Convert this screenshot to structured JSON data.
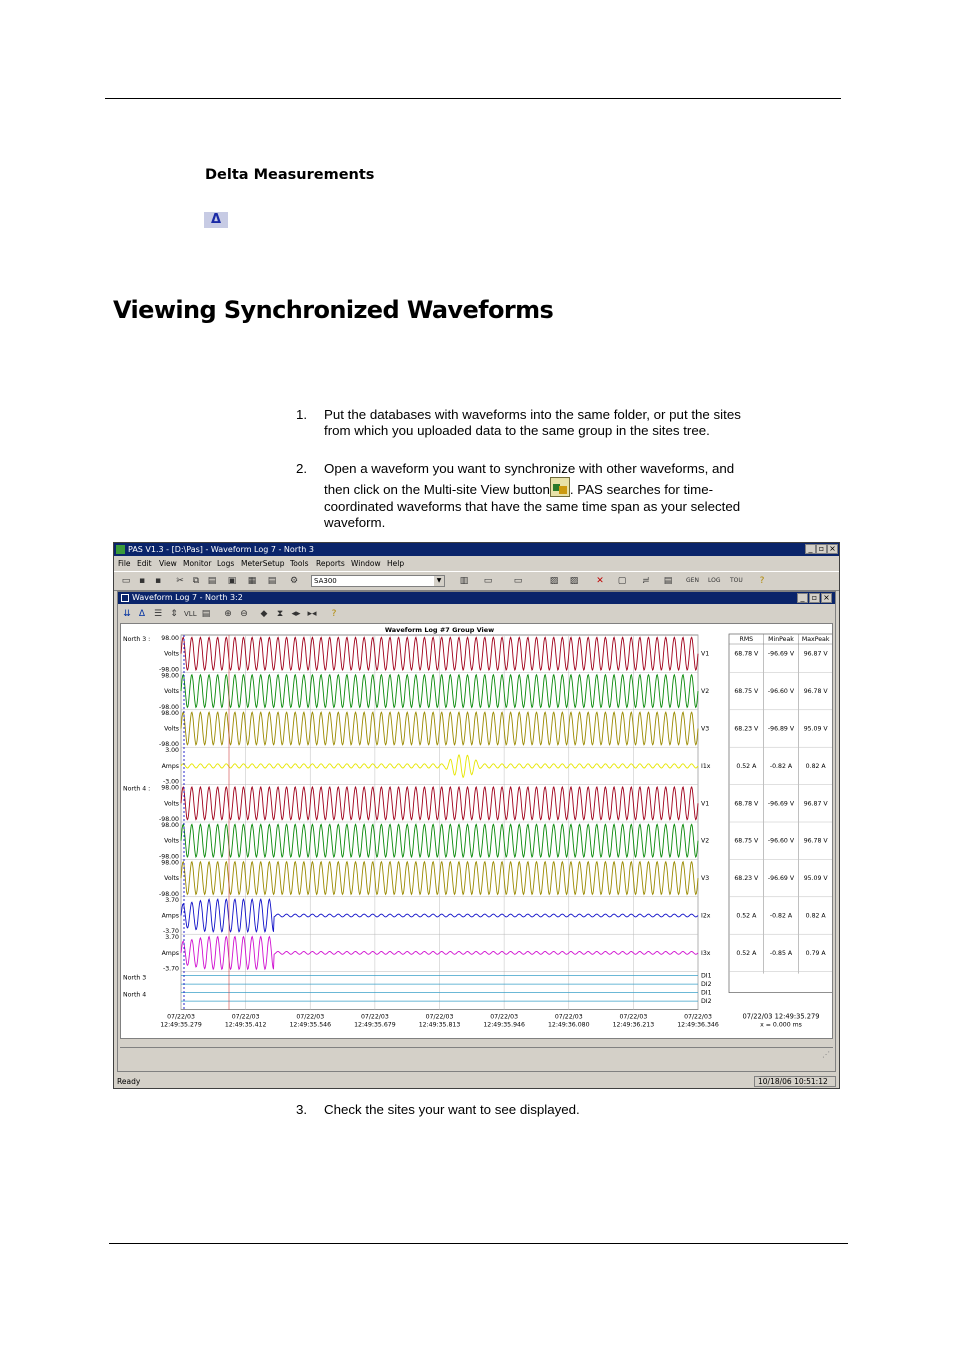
{
  "section_heading": "Delta Measurements",
  "delta_icon": "Δ",
  "page_title": "Viewing Synchronized Waveforms",
  "steps": [
    {
      "num": "1.",
      "text": "Put the databases with waveforms into the same folder, or put the sites from which you uploaded data to the same group in the sites tree."
    },
    {
      "num": "2.",
      "text_before": "Open a waveform you want to synchronize with other waveforms, and then click on the Multi-site View button",
      "text_after": ". PAS searches for time-coordinated waveforms that have the same time span as your selected waveform."
    },
    {
      "num": "3.",
      "text": "Check the sites your want to see displayed."
    }
  ],
  "app": {
    "title": "PAS V1.3 - [D:\\Pas] - Waveform Log 7 - North 3",
    "menu": [
      "File",
      "Edit",
      "View",
      "Monitor",
      "Logs",
      "MeterSetup",
      "Tools",
      "Reports",
      "Window",
      "Help"
    ],
    "combo_value": "SA300",
    "child_title": "Waveform Log 7 - North 3:2",
    "chart_title": "Waveform Log #7 Group View",
    "status_left": "Ready",
    "status_right": "10/18/06 10:51:12"
  },
  "chart_data": {
    "type": "line",
    "title": "Waveform Log #7 Group View",
    "groups": [
      "North 3 :",
      "North 4 :"
    ],
    "channels": [
      {
        "group": "North 3",
        "label": "V1",
        "unit": "Volts",
        "max": "98.00",
        "min": "-98.00",
        "color": "#a0001a",
        "amp": 0.95,
        "disturb": "none"
      },
      {
        "group": "North 3",
        "label": "V2",
        "unit": "Volts",
        "max": "98.00",
        "min": "-98.00",
        "color": "#0a8a0a",
        "amp": 0.95,
        "disturb": "none"
      },
      {
        "group": "North 3",
        "label": "V3",
        "unit": "Volts",
        "max": "98.00",
        "min": "-98.00",
        "color": "#9a8a00",
        "amp": 0.95,
        "disturb": "none"
      },
      {
        "group": "North 3",
        "label": "I1x",
        "unit": "Amps",
        "max": "3.00",
        "min": "-3.00",
        "color": "#e6e600",
        "amp": 0.12,
        "disturb": "mid"
      },
      {
        "group": "North 4",
        "label": "V1",
        "unit": "Volts",
        "max": "98.00",
        "min": "-98.00",
        "color": "#a0001a",
        "amp": 0.95,
        "disturb": "none"
      },
      {
        "group": "North 4",
        "label": "V2",
        "unit": "Volts",
        "max": "98.00",
        "min": "-98.00",
        "color": "#0a8a0a",
        "amp": 0.95,
        "disturb": "none"
      },
      {
        "group": "North 4",
        "label": "V3",
        "unit": "Volts",
        "max": "98.00",
        "min": "-98.00",
        "color": "#9a8a00",
        "amp": 0.95,
        "disturb": "none"
      },
      {
        "group": "North 4",
        "label": "I2x",
        "unit": "Amps",
        "max": "3.70",
        "min": "-3.70",
        "color": "#1010c8",
        "amp": 0.08,
        "disturb": "start"
      },
      {
        "group": "North 4",
        "label": "I3x",
        "unit": "Amps",
        "max": "3.70",
        "min": "-3.70",
        "color": "#d010d0",
        "amp": 0.08,
        "disturb": "start"
      }
    ],
    "digital_groups": [
      "North 3",
      "North 4"
    ],
    "digital_labels": [
      "DI1",
      "DI2",
      "DI1",
      "DI2"
    ],
    "x_ticks": [
      [
        "07/22/03",
        "12:49:35.279"
      ],
      [
        "07/22/03",
        "12:49:35.412"
      ],
      [
        "07/22/03",
        "12:49:35.546"
      ],
      [
        "07/22/03",
        "12:49:35.679"
      ],
      [
        "07/22/03",
        "12:49:35.813"
      ],
      [
        "07/22/03",
        "12:49:35.946"
      ],
      [
        "07/22/03",
        "12:49:36.080"
      ],
      [
        "07/22/03",
        "12:49:36.213"
      ],
      [
        "07/22/03",
        "12:49:36.346"
      ]
    ],
    "table_headers": [
      "RMS",
      "MinPeak",
      "MaxPeak"
    ],
    "table_rows": [
      [
        "68.78 V",
        "-96.69 V",
        "96.87 V"
      ],
      [
        "68.75 V",
        "-96.60 V",
        "96.78 V"
      ],
      [
        "68.23 V",
        "-96.89 V",
        "95.09 V"
      ],
      [
        "0.52 A",
        "-0.82 A",
        "0.82 A"
      ],
      [
        "68.78 V",
        "-96.69 V",
        "96.87 V"
      ],
      [
        "68.75 V",
        "-96.60 V",
        "96.78 V"
      ],
      [
        "68.23 V",
        "-96.69 V",
        "95.09 V"
      ],
      [
        "0.52 A",
        "-0.82 A",
        "0.82 A"
      ],
      [
        "0.52 A",
        "-0.85 A",
        "0.79 A"
      ]
    ],
    "cursor_time": "07/22/03 12:49:35.279",
    "cursor_delta": "x = 0.000 ms"
  }
}
